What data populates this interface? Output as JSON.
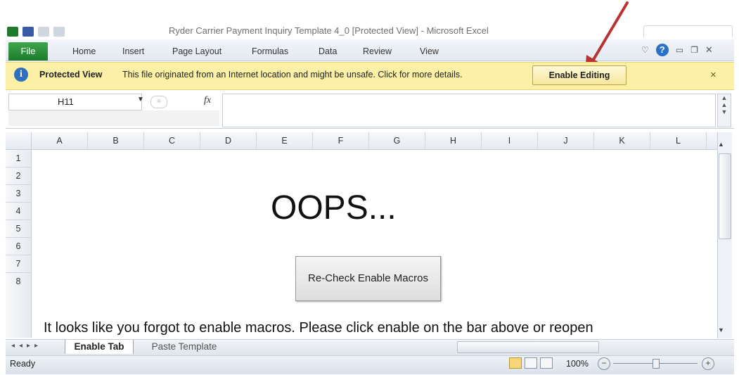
{
  "window": {
    "title": "Ryder Carrier Payment Inquiry Template 4_0 [Protected View] - Microsoft Excel"
  },
  "ribbon": {
    "file_label": "File",
    "tabs": [
      {
        "label": "Home"
      },
      {
        "label": "Insert"
      },
      {
        "label": "Page Layout"
      },
      {
        "label": "Formulas"
      },
      {
        "label": "Data"
      },
      {
        "label": "Review"
      },
      {
        "label": "View"
      }
    ],
    "help_glyph": "?"
  },
  "protected_view": {
    "title": "Protected View",
    "message": "This file originated from an Internet location and might be unsafe. Click for more details.",
    "enable_button": "Enable Editing",
    "close_glyph": "×",
    "info_glyph": "i"
  },
  "formula_bar": {
    "name_box": "H11",
    "fx_label": "fx",
    "formula_value": ""
  },
  "grid": {
    "columns": [
      "A",
      "B",
      "C",
      "D",
      "E",
      "F",
      "G",
      "H",
      "I",
      "J",
      "K",
      "L"
    ],
    "rows": [
      "1",
      "2",
      "3",
      "4",
      "5",
      "6",
      "7",
      "8"
    ]
  },
  "content": {
    "heading": "OOPS...",
    "button_label": "Re-Check Enable Macros",
    "message": "It looks like you forgot to enable macros.  Please click enable on the bar above or reopen"
  },
  "sheet_tabs": [
    {
      "label": "Enable Tab",
      "active": true
    },
    {
      "label": "Paste Template",
      "active": false
    }
  ],
  "status": {
    "ready": "Ready",
    "zoom": "100%",
    "minus_glyph": "−",
    "plus_glyph": "+"
  },
  "colors": {
    "file_tab": "#1f7b2c",
    "protected_bar": "#fbf0a6",
    "arrow": "#b83232"
  },
  "icons": [
    "excel-icon",
    "save-icon",
    "undo-icon",
    "redo-icon",
    "info-icon",
    "help-icon",
    "minimize-icon",
    "restore-icon",
    "close-icon",
    "fx-icon",
    "dropdown-arrow-icon"
  ]
}
